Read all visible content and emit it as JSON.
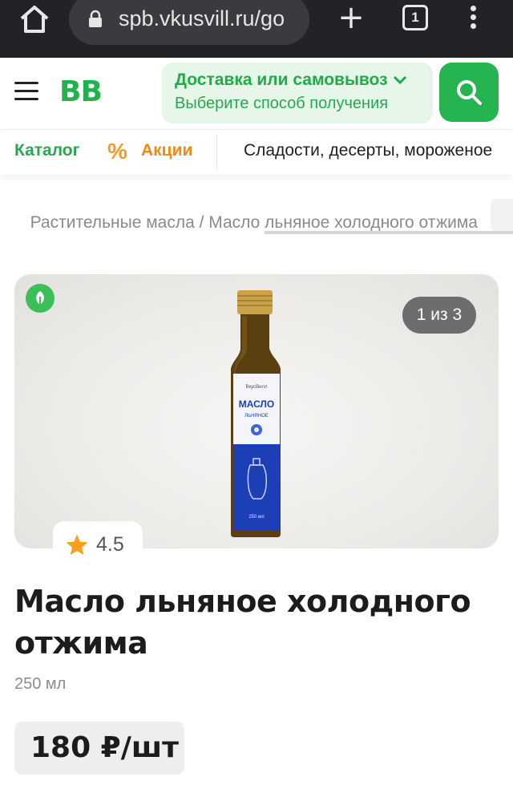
{
  "browser": {
    "url": "spb.vkusvill.ru/go",
    "tab_count": "1",
    "plus_label": "+"
  },
  "header": {
    "logo": "ВВ",
    "delivery_title": "Доставка или самовывоз",
    "delivery_subtitle": "Выберите способ получения"
  },
  "nav": {
    "catalog": "Каталог",
    "promo_icon": "%",
    "promo": "Акции",
    "category": "Сладости, десерты, мороженое"
  },
  "breadcrumb": "Растительные масла / Масло льняное холодного отжима",
  "gallery": {
    "counter": "1 из 3",
    "bottle_brand": "ВкусВилл",
    "bottle_title": "МАСЛО",
    "bottle_subtitle": "ЛЬНЯНОЕ",
    "bottle_volume": "250 мл"
  },
  "product": {
    "rating": "4.5",
    "title": "Масло льняное холодного отжима",
    "volume": "250 мл",
    "price": "180 ₽/шт"
  },
  "colors": {
    "brand_green": "#22b14c",
    "promo_orange": "#f08a12",
    "delivery_bg": "#e6f7ea"
  }
}
